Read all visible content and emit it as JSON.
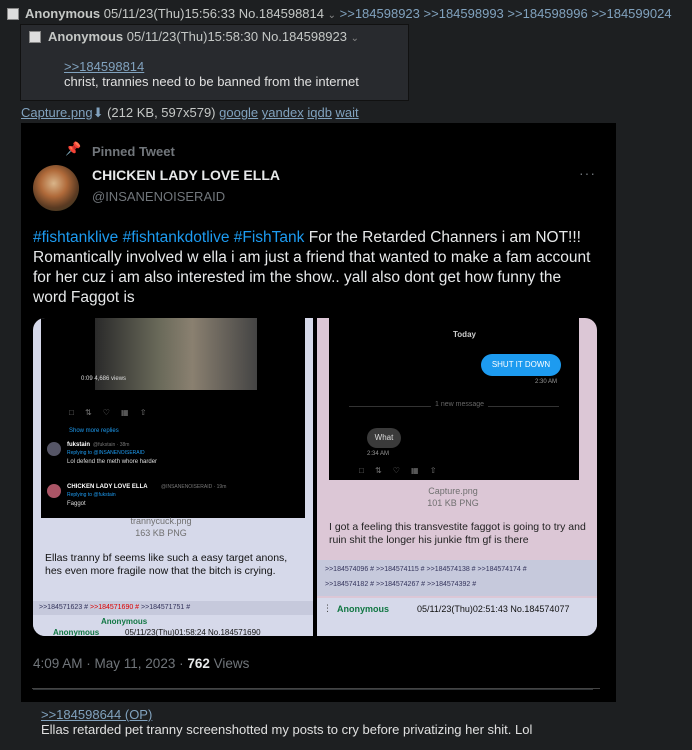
{
  "post": {
    "name": "Anonymous",
    "datetime": "05/11/23(Thu)15:56:33",
    "number": "No.184598814",
    "backlinks": [
      ">>184598923",
      ">>184598993",
      ">>184598996",
      ">>184599024"
    ]
  },
  "reply": {
    "name": "Anonymous",
    "datetime": "05/11/23(Thu)15:58:30",
    "number": "No.184598923",
    "quote": ">>184598814",
    "text": "christ, trannies need to be banned from the internet"
  },
  "file": {
    "name": "Capture.png",
    "info": "(212 KB, 597x579)",
    "search_links": [
      "google",
      "yandex",
      "iqdb",
      "wait"
    ]
  },
  "tweet": {
    "pinned_label": "Pinned Tweet",
    "display_name": "CHICKEN LADY LOVE ELLA",
    "handle": "@INSANENOISERAID",
    "hashtags": [
      "#fishtanklive",
      "#fishtankdotlive",
      "#FishTank"
    ],
    "text_after_hashtags": "For the Retarded Channers i am NOT!!! Romantically involved w ella i am just a friend that wanted to make a fam account for her cuz i am also interested im the show.. yall also dont get how funny the word Faggot is",
    "timestamp": "4:09 AM · May 11, 2023 · ",
    "views_count": "762",
    "views_label": " Views",
    "media_left": {
      "video_time": "0:09  4,686 views",
      "show_more": "Show more replies",
      "r1_name": "fukstain",
      "r1_meta": "@fukstain · 38m",
      "r1_replying": "Replying to @INSANENOISERAID",
      "r1_text": "Lol defend the meth whore harder",
      "r2_name": "CHICKEN LADY LOVE ELLA",
      "r2_meta": "@INSANENOISERAID · 19m",
      "r2_replying": "Replying to @fukstain",
      "r2_text": "Faggot",
      "file_name": "trannycuck.png",
      "file_size": "163 KB PNG",
      "post_text": "Ellas tranny bf seems like such a easy target anons, hes even more fragile now that the bitch is crying.",
      "links": [
        ">>184571623 #",
        ">>184571690 #",
        ">>184571751 #"
      ],
      "footer_name": "Anonymous",
      "footer_name2": "Anonymous",
      "footer_date": "05/11/23(Thu)01:58:24 No.184571690"
    },
    "media_right": {
      "day": "Today",
      "bubble_out": "SHUT IT DOWN",
      "bubble_out_time": "2:30 AM",
      "new_message": "1 new message",
      "bubble_in": "What",
      "bubble_in_time": "2:34 AM",
      "file_name": "Capture.png",
      "file_size": "101 KB PNG",
      "post_text": "I got a feeling this transvestite faggot is going to try and ruin shit the longer his junkie ftm gf is there",
      "links_row1": [
        ">>184574096 #",
        ">>184574115 #",
        ">>184574138 #",
        ">>184574174 #"
      ],
      "links_row2": [
        ">>184574182 #",
        ">>184574267 #",
        ">>184574392 #"
      ],
      "footer_name": "Anonymous",
      "footer_date": "05/11/23(Thu)02:51:43 No.184574077"
    }
  },
  "bottom": {
    "quote": ">>184598644 (OP)",
    "text": "Ellas retarded pet tranny screenshotted my posts to cry before privatizing her shit. Lol"
  },
  "colors": {
    "page_bg": "#1d1f21",
    "reply_bg": "#282a2e",
    "link": "#81a2be",
    "hashtag": "#1d9bf0",
    "tweet_bg": "#000000"
  }
}
